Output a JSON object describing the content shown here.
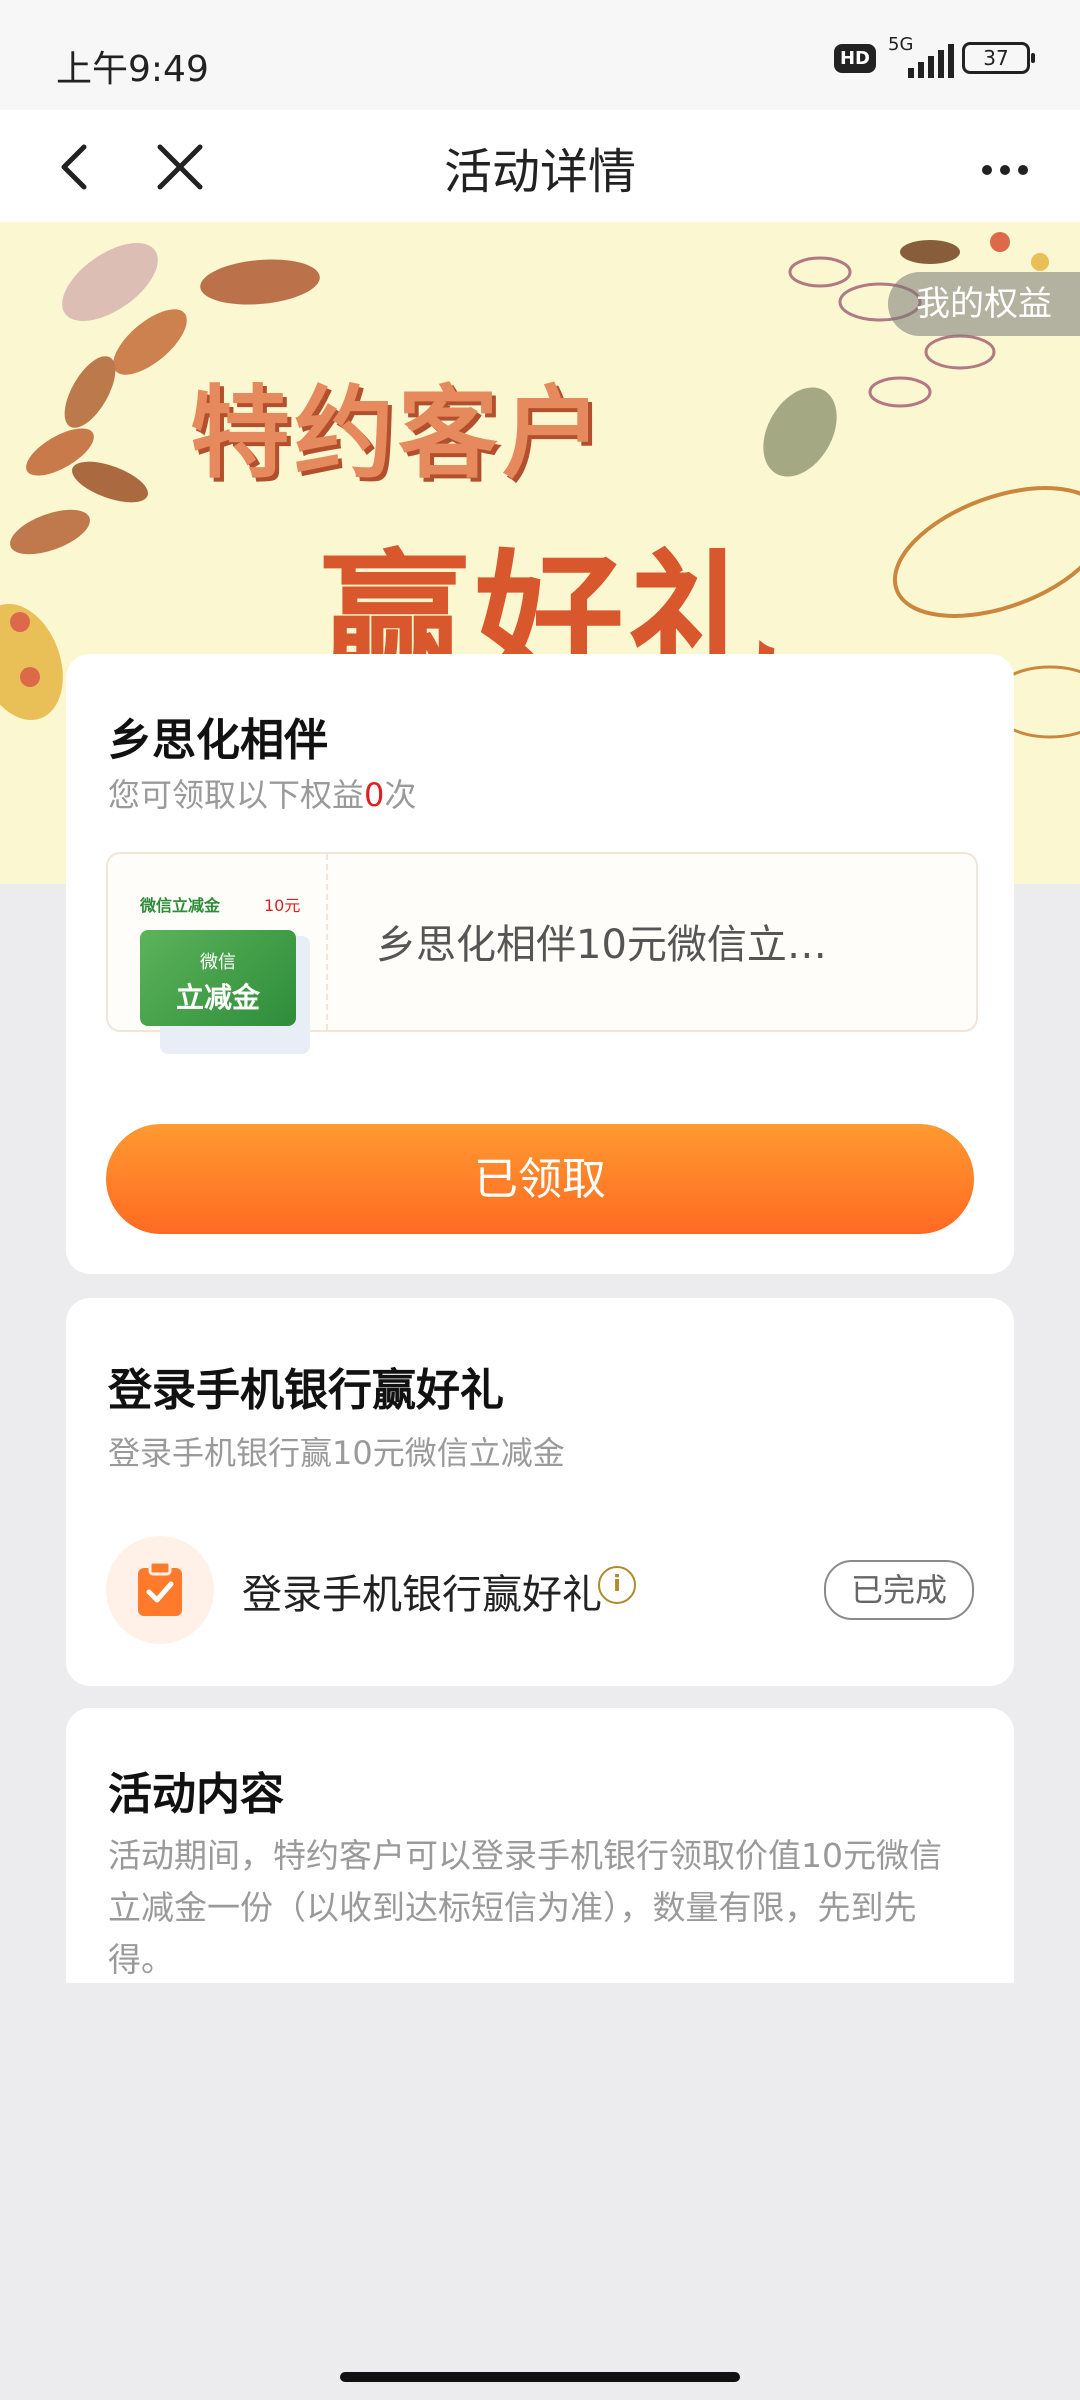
{
  "status_bar": {
    "time": "上午9:49",
    "hd": "HD",
    "network": "5G",
    "battery": "37"
  },
  "nav": {
    "title": "活动详情"
  },
  "banner": {
    "title_line1": "特约客户",
    "title_line2": "赢好礼",
    "my_rights": "我的权益"
  },
  "card_reward": {
    "title": "乡思化相伴",
    "subtitle_prefix": "您可领取以下权益",
    "count": "0",
    "subtitle_suffix": "次",
    "coupon": {
      "tag": "微信立减金",
      "amount": "10元",
      "card_line1": "微信",
      "card_line2": "立减金",
      "name": "乡思化相伴10元微信立…"
    },
    "button_label": "已领取"
  },
  "card_task": {
    "title": "登录手机银行赢好礼",
    "subtitle": "登录手机银行赢10元微信立减金",
    "task_label": "登录手机银行赢好礼",
    "info": "i",
    "status": "已完成"
  },
  "card_content": {
    "title": "活动内容",
    "body": "活动期间，特约客户可以登录手机银行领取价值10元微信立减金一份（以收到达标短信为准），数量有限，先到先得。"
  }
}
